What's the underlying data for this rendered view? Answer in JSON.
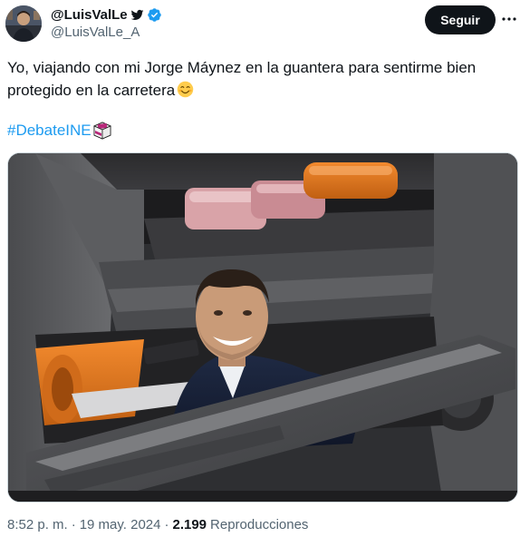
{
  "author": {
    "display_name": "@LuisValLe",
    "handle": "@LuisValLe_A",
    "verified": true,
    "avatar_icon": "avatar-icon",
    "bird_icon": "bird-icon"
  },
  "follow_button": {
    "label": "Seguir"
  },
  "more_button": {
    "label": "···",
    "icon": "more-icon"
  },
  "tweet": {
    "text": "Yo, viajando con mi Jorge Máynez en la guantera para sentirme bien protegido en la carretera",
    "emoji": "smiling-face-emoji",
    "hashtag": "#DebateINE",
    "hashtag_icon": "ballot-box-icon"
  },
  "media": {
    "description_icon": "glovebox-photo"
  },
  "meta": {
    "time": "8:52 p. m.",
    "separator_1": "·",
    "date": "19 may. 2024",
    "separator_2": "·",
    "views_count": "2.199",
    "views_label": "Reproducciones"
  },
  "colors": {
    "link": "#1d9bf0",
    "secondary_text": "#536471",
    "primary_text": "#0f1419",
    "button_bg": "#0f1419",
    "verified": "#1d9bf0"
  }
}
